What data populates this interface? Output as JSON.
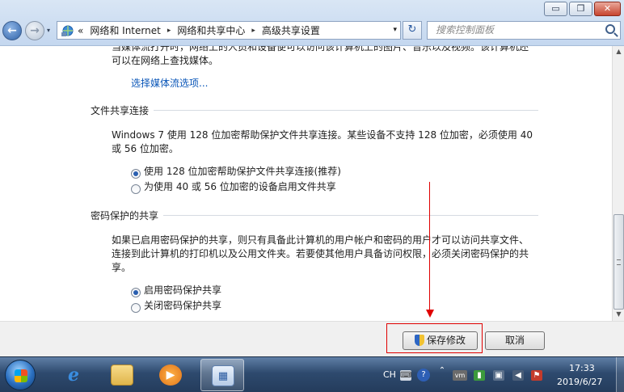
{
  "window": {
    "minimize_glyph": "▭",
    "maximize_glyph": "❐",
    "close_glyph": "✕"
  },
  "nav": {
    "back_glyph": "←",
    "forward_glyph": "→",
    "history_glyph": "▾"
  },
  "address": {
    "overflow": "«",
    "separator": "▸",
    "crumbs": [
      "网络和 Internet",
      "网络和共享中心",
      "高级共享设置"
    ],
    "dropdown_glyph": "▾",
    "refresh_glyph": "↻"
  },
  "search": {
    "placeholder": "搜索控制面板"
  },
  "content": {
    "partial_line_1": "当媒体流打开时，网络上的人员和设备便可以访问该计算机上的图片、音乐以及视频。该计算机还",
    "partial_line_2": "可以在网络上查找媒体。",
    "media_link": "选择媒体流选项...",
    "file_sharing": {
      "title": "文件共享连接",
      "desc_line_1": "Windows 7 使用 128 位加密帮助保护文件共享连接。某些设备不支持 128 位加密，必须使用 40",
      "desc_line_2": "或 56 位加密。",
      "options": [
        {
          "label": "使用 128 位加密帮助保护文件共享连接(推荐)",
          "selected": true
        },
        {
          "label": "为使用 40 或 56 位加密的设备启用文件共享",
          "selected": false
        }
      ]
    },
    "password_sharing": {
      "title": "密码保护的共享",
      "desc_line_1": "如果已启用密码保护的共享，则只有具备此计算机的用户帐户和密码的用户才可以访问共享文件、",
      "desc_line_2": "连接到此计算机的打印机以及公用文件夹。若要使其他用户具备访问权限，必须关闭密码保护的共",
      "desc_line_3": "享。",
      "options": [
        {
          "label": "启用密码保护共享",
          "selected": true
        },
        {
          "label": "关闭密码保护共享",
          "selected": false
        }
      ]
    }
  },
  "buttons": {
    "save": "保存修改",
    "cancel": "取消"
  },
  "scrollbar": {
    "up_glyph": "▲",
    "down_glyph": "▼"
  },
  "taskbar": {
    "items": [
      {
        "name": "internet-explorer",
        "glyph": "e"
      },
      {
        "name": "windows-explorer",
        "glyph": ""
      },
      {
        "name": "media-player",
        "glyph": "▶"
      },
      {
        "name": "control-panel",
        "glyph": "▦"
      }
    ],
    "language": "CH",
    "tray_glyphs": {
      "keyboard": "⌨",
      "help": "?",
      "pin": "⌃",
      "vm": "vm",
      "network": "▮",
      "display": "▣",
      "volume": "◀",
      "flag": "⚑"
    },
    "time": "17:33",
    "date": "2019/6/27"
  }
}
